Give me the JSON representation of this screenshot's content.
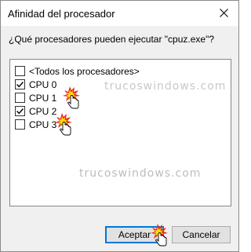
{
  "window": {
    "title": "Afinidad del procesador",
    "close_icon": "close-icon"
  },
  "prompt": "¿Qué procesadores pueden ejecutar \"cpuz.exe\"?",
  "list": {
    "items": [
      {
        "label": "<Todos los procesadores>",
        "checked": false
      },
      {
        "label": "CPU 0",
        "checked": true
      },
      {
        "label": "CPU 1",
        "checked": false
      },
      {
        "label": "CPU 2",
        "checked": true
      },
      {
        "label": "CPU 3",
        "checked": false
      }
    ]
  },
  "watermark": "truco s w i n d o w s . c o m",
  "watermark_text": "trucoswindows.com",
  "buttons": {
    "accept": "Aceptar",
    "cancel": "Cancelar"
  },
  "colors": {
    "accent": "#0078d7",
    "burst": "#e8231b",
    "burst_inner": "#ffe100"
  }
}
